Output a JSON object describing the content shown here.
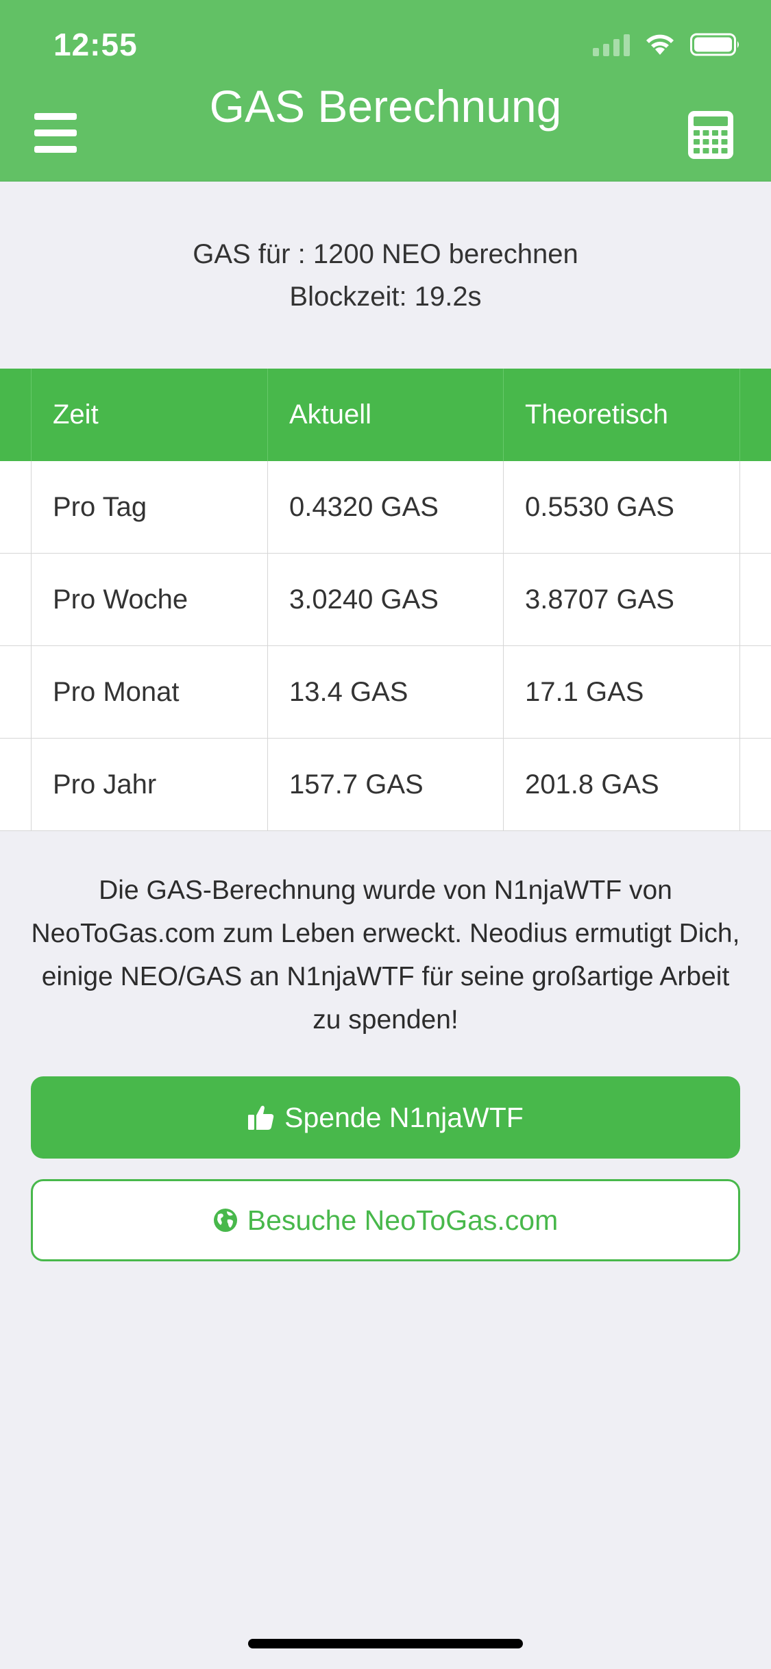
{
  "status_bar": {
    "time": "12:55",
    "icons": [
      "cellular-signal-icon",
      "wifi-icon",
      "battery-icon"
    ]
  },
  "nav": {
    "title": "GAS Berechnung",
    "left_icon": "hamburger-menu-icon",
    "right_icon": "calculator-icon"
  },
  "info": {
    "line1": "GAS für : 1200 NEO berechnen",
    "line2": "Blockzeit: 19.2s"
  },
  "table": {
    "headers": [
      "Zeit",
      "Aktuell",
      "Theoretisch"
    ],
    "rows": [
      [
        "Pro Tag",
        "0.4320 GAS",
        "0.5530 GAS"
      ],
      [
        "Pro Woche",
        "3.0240 GAS",
        "3.8707 GAS"
      ],
      [
        "Pro Monat",
        "13.4 GAS",
        "17.1 GAS"
      ],
      [
        "Pro Jahr",
        "157.7 GAS",
        "201.8 GAS"
      ]
    ]
  },
  "credit": {
    "text": "Die GAS-Berechnung wurde von N1njaWTF von NeoToGas.com zum Leben erweckt. Neodius ermutigt Dich, einige NEO/GAS an N1njaWTF für seine großartige Arbeit zu spenden!"
  },
  "buttons": {
    "donate_label": "Spende N1njaWTF",
    "donate_icon": "thumbs-up-icon",
    "visit_label": "Besuche NeoToGas.com",
    "visit_icon": "globe-icon"
  },
  "colors": {
    "primary_green": "#48b84b",
    "nav_green": "#62c165",
    "background": "#efeff4"
  }
}
